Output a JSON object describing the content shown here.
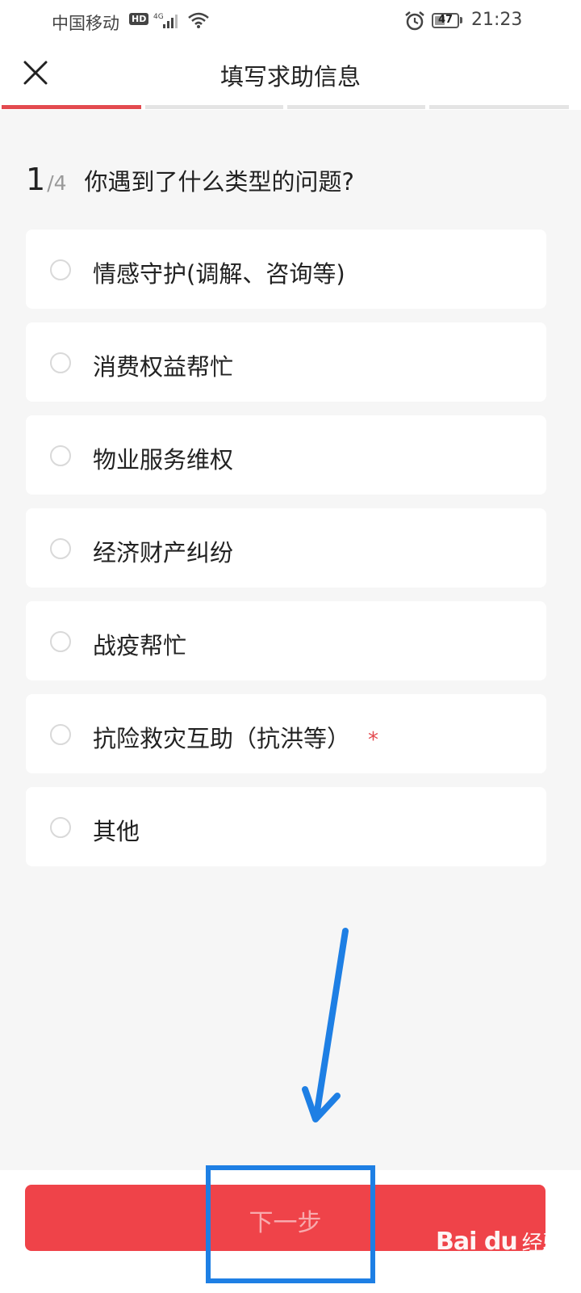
{
  "status_bar": {
    "carrier": "中国移动",
    "hd": "HD",
    "network": "4G",
    "battery": "47",
    "battery_level": 0.47,
    "time": "21:23"
  },
  "header": {
    "title": "填写求助信息"
  },
  "progress": {
    "total_steps": 4,
    "current_step": 1,
    "active_color": "#e34a4f",
    "inactive_color": "#e4e4e4"
  },
  "question": {
    "number": "1",
    "total": "/4",
    "text": "你遇到了什么类型的问题?"
  },
  "options": [
    {
      "label": "情感守护(调解、咨询等)",
      "required": ""
    },
    {
      "label": "消费权益帮忙",
      "required": ""
    },
    {
      "label": "物业服务维权",
      "required": ""
    },
    {
      "label": "经济财产纠纷",
      "required": ""
    },
    {
      "label": "战疫帮忙",
      "required": ""
    },
    {
      "label": "抗险救灾互助（抗洪等）",
      "required": "*"
    },
    {
      "label": "其他",
      "required": ""
    }
  ],
  "footer": {
    "next_label": "下一步",
    "button_color": "#ef4349"
  },
  "annotation": {
    "color": "#1e7fe4"
  },
  "watermark": {
    "brand": "Bai du",
    "name": "经验",
    "url": "jingyan.baidu.com"
  }
}
